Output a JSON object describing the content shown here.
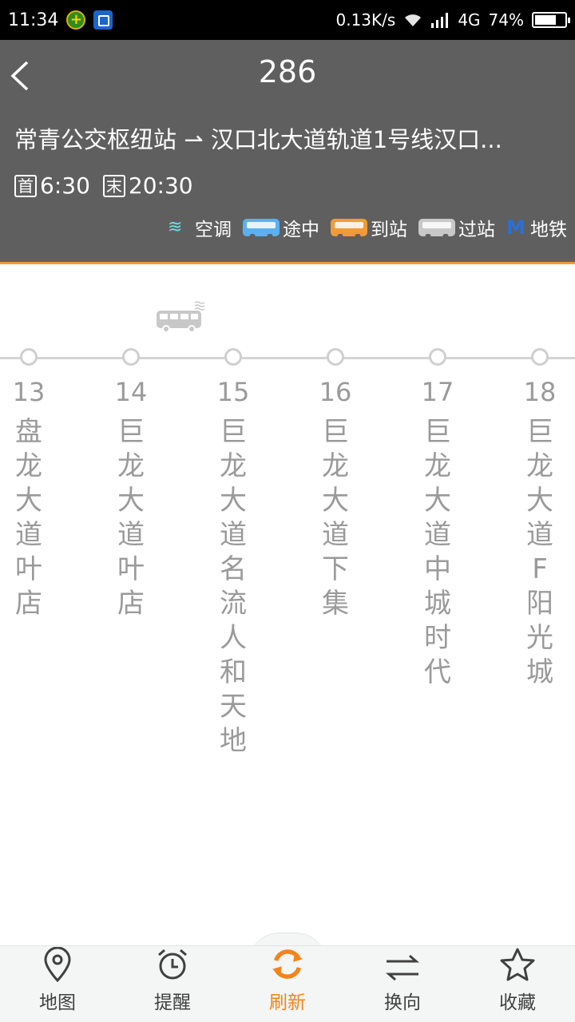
{
  "status_bar": {
    "time": "11:34",
    "network_speed": "0.13K/s",
    "network_type": "4G",
    "battery_percent": "74%",
    "battery_level": 0.74
  },
  "header": {
    "route_number": "286",
    "direction": "常青公交枢纽站 ⇀ 汉口北大道轨道1号线汉口...",
    "first_label": "首",
    "first_time": "6:30",
    "last_label": "末",
    "last_time": "20:30",
    "legend": {
      "ac": "空调",
      "en_route": "途中",
      "arrived": "到站",
      "passed": "过站",
      "metro": "地铁"
    }
  },
  "colors": {
    "header_bg": "#5f5f5f",
    "accent": "#f39a34",
    "en_route": "#5ab0f0",
    "arrived": "#f39a34",
    "passed": "#c8c8c8",
    "ac": "#6ee0e6",
    "metro": "#2c6fd6",
    "station_text": "#9a9a9a"
  },
  "stations": [
    {
      "num": "13",
      "name": "盘龙大道叶店"
    },
    {
      "num": "14",
      "name": "巨龙大道叶店"
    },
    {
      "num": "15",
      "name": "巨龙大道名流人和天地"
    },
    {
      "num": "16",
      "name": "巨龙大道下集"
    },
    {
      "num": "17",
      "name": "巨龙大道中城时代"
    },
    {
      "num": "18",
      "name": "巨龙大道F阳光城"
    }
  ],
  "bottom_nav": {
    "map": "地图",
    "reminder": "提醒",
    "refresh": "刷新",
    "reverse": "换向",
    "favorite": "收藏"
  }
}
